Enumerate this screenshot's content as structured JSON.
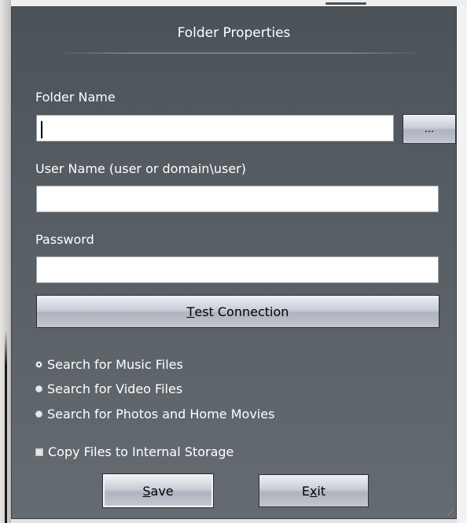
{
  "dialog": {
    "title": "Folder Properties",
    "folder_name": {
      "label": "Folder Name",
      "value": "",
      "browse_label": "..."
    },
    "user_name": {
      "label": "User Name (user or domain\\user)",
      "value": ""
    },
    "password": {
      "label": "Password",
      "value": ""
    },
    "test_connection": {
      "mnemonic": "T",
      "rest": "est Connection"
    },
    "search_options": [
      {
        "label": "Search for Music Files",
        "selected": true
      },
      {
        "label": "Search for Video Files",
        "selected": false
      },
      {
        "label": "Search for Photos and Home Movies",
        "selected": false
      }
    ],
    "copy_files": {
      "label": "Copy Files to Internal Storage",
      "checked": false
    },
    "save_button": {
      "mnemonic": "S",
      "rest": "ave"
    },
    "exit_button": {
      "before": "E",
      "mnemonic": "x",
      "after": "it"
    }
  }
}
